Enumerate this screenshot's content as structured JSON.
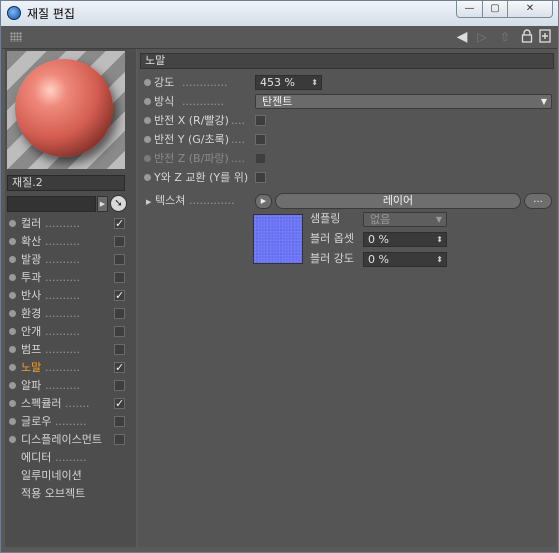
{
  "window": {
    "title": "재질 편집",
    "minimize_glyph": "—",
    "maximize_glyph": "▢",
    "close_glyph": "✕"
  },
  "toolbar": {
    "icons": [
      "grip-icon",
      "arrow-left-icon",
      "arrow-right-icon",
      "up-icon",
      "lock-icon",
      "new-panel-icon"
    ]
  },
  "sidebar": {
    "material_name": "재질.2",
    "channels": [
      {
        "label": "컬러",
        "dots": "..........",
        "checked": true,
        "active": false
      },
      {
        "label": "확산",
        "dots": "..........",
        "checked": false,
        "active": false
      },
      {
        "label": "발광",
        "dots": "..........",
        "checked": false,
        "active": false
      },
      {
        "label": "투과",
        "dots": "..........",
        "checked": false,
        "active": false
      },
      {
        "label": "반사",
        "dots": "..........",
        "checked": true,
        "active": false
      },
      {
        "label": "환경",
        "dots": "..........",
        "checked": false,
        "active": false
      },
      {
        "label": "안개",
        "dots": "..........",
        "checked": false,
        "active": false
      },
      {
        "label": "범프",
        "dots": "..........",
        "checked": false,
        "active": false
      },
      {
        "label": "노말",
        "dots": "..........",
        "checked": true,
        "active": true
      },
      {
        "label": "알파",
        "dots": "..........",
        "checked": false,
        "active": false
      },
      {
        "label": "스펙큘러",
        "dots": ".......",
        "checked": true,
        "active": false
      },
      {
        "label": "글로우",
        "dots": ".........",
        "checked": false,
        "active": false
      },
      {
        "label": "디스플레이스먼트",
        "dots": "",
        "checked": false,
        "active": false
      }
    ],
    "extras": [
      {
        "label": "에디터",
        "dots": "........."
      },
      {
        "label": "일루미네이션",
        "dots": ""
      },
      {
        "label": "적용 오브젝트",
        "dots": ""
      }
    ]
  },
  "panel": {
    "header": "노말",
    "strength_label": "강도",
    "strength_dots": ".............",
    "strength_value": "453 %",
    "method_label": "방식",
    "method_dots": "............",
    "method_value": "탄젠트",
    "flip_x_label": "반전 X (R/빨강)",
    "flip_x_dots": "....",
    "flip_y_label": "반전 Y (G/초록)",
    "flip_y_dots": "....",
    "flip_z_label": "반전 Z (B/파랑)",
    "flip_z_dots": "....",
    "swap_label": "Y와 Z 교환 (Y를 위)",
    "texture_label": "텍스쳐",
    "texture_dots": ".............",
    "layer_button": "레이어",
    "more_button": "...",
    "sampling_label": "샘플링",
    "sampling_value": "없음",
    "blur_offset_label": "블러 옵셋",
    "blur_offset_value": "0 %",
    "blur_strength_label": "블러 강도",
    "blur_strength_value": "0 %"
  }
}
